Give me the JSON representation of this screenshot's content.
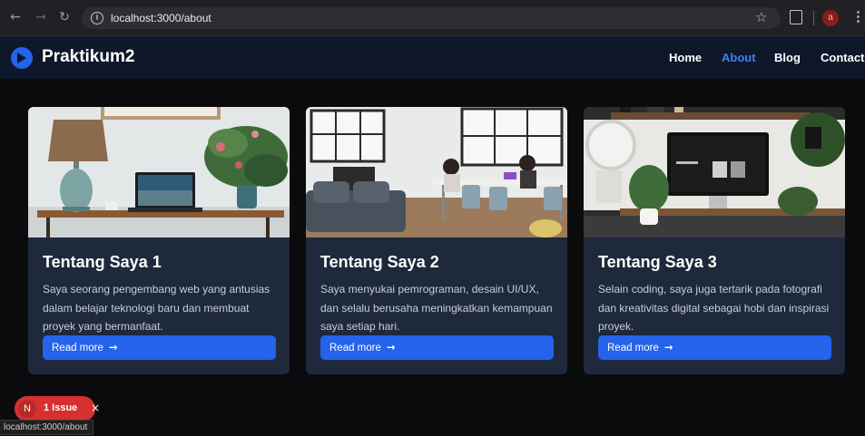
{
  "browser": {
    "url": "localhost:3000/about",
    "back_icon": "←",
    "forward_icon": "→",
    "reload_icon": "↻",
    "star_icon": "☆",
    "profile_initial": "a",
    "menu_icon": "⋮"
  },
  "site": {
    "brand": "Praktikum2",
    "nav": [
      {
        "label": "Home"
      },
      {
        "label": "About"
      },
      {
        "label": "Blog"
      },
      {
        "label": "Contact"
      }
    ],
    "active_nav": "About"
  },
  "cards": [
    {
      "title": "Tentang Saya 1",
      "text": "Saya seorang pengembang web yang antusias dalam belajar teknologi baru dan membuat proyek yang bermanfaat.",
      "button": "Read more",
      "arrow": "→"
    },
    {
      "title": "Tentang Saya 2",
      "text": "Saya menyukai pemrograman, desain UI/UX, dan selalu berusaha meningkatkan kemampuan saya setiap hari.",
      "button": "Read more",
      "arrow": "→"
    },
    {
      "title": "Tentang Saya 3",
      "text": "Selain coding, saya juga tertarik pada fotografi dan kreativitas digital sebagai hobi dan inspirasi proyek.",
      "button": "Read more",
      "arrow": "→"
    }
  ],
  "dev_overlay": {
    "badge_letter": "N",
    "issues_label": "1 Issue",
    "close": "×"
  },
  "status_bar": "localhost:3000/about",
  "colors": {
    "accent": "#2563eb",
    "active_link": "#3b82f6",
    "header_bg": "#0f172a",
    "card_bg": "#1e293b",
    "issue_red": "#d63031"
  }
}
